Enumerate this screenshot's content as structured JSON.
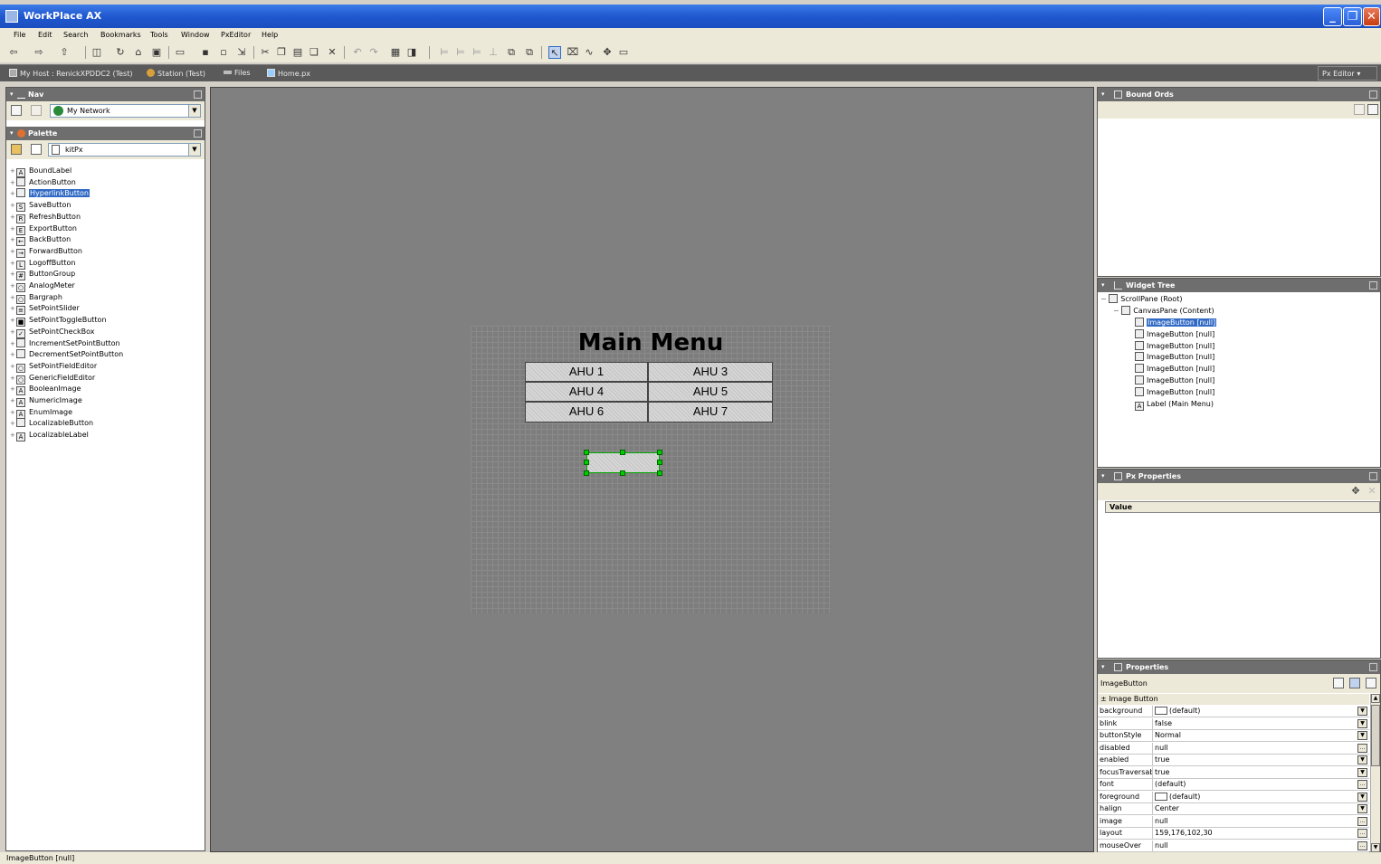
{
  "window": {
    "title": "WorkPlace AX"
  },
  "menu": [
    "File",
    "Edit",
    "Search",
    "Bookmarks",
    "Tools",
    "Window",
    "PxEditor",
    "Help"
  ],
  "location": {
    "crumbs": [
      "My Host : RenickXPDDC2 (Test)",
      "Station (Test)",
      "Files",
      "Home.px"
    ],
    "view_selector": "Px Editor"
  },
  "nav": {
    "title": "Nav",
    "selection": "My Network"
  },
  "palette": {
    "title": "Palette",
    "module": "kitPx",
    "items": [
      {
        "label": "BoundLabel",
        "icon": "A"
      },
      {
        "label": "ActionButton",
        "icon": ""
      },
      {
        "label": "HyperlinkButton",
        "icon": "",
        "selected": true
      },
      {
        "label": "SaveButton",
        "icon": "S"
      },
      {
        "label": "RefreshButton",
        "icon": "R"
      },
      {
        "label": "ExportButton",
        "icon": "E"
      },
      {
        "label": "BackButton",
        "icon": "←"
      },
      {
        "label": "ForwardButton",
        "icon": "→"
      },
      {
        "label": "LogoffButton",
        "icon": "L"
      },
      {
        "label": "ButtonGroup",
        "icon": "#"
      },
      {
        "label": "AnalogMeter",
        "icon": "○"
      },
      {
        "label": "Bargraph",
        "icon": "○"
      },
      {
        "label": "SetPointSlider",
        "icon": "≡"
      },
      {
        "label": "SetPointToggleButton",
        "icon": "■"
      },
      {
        "label": "SetPointCheckBox",
        "icon": "✓"
      },
      {
        "label": "IncrementSetPointButton",
        "icon": ""
      },
      {
        "label": "DecrementSetPointButton",
        "icon": ""
      },
      {
        "label": "SetPointFieldEditor",
        "icon": "○"
      },
      {
        "label": "GenericFieldEditor",
        "icon": "○"
      },
      {
        "label": "BooleanImage",
        "icon": "A"
      },
      {
        "label": "NumericImage",
        "icon": "A"
      },
      {
        "label": "EnumImage",
        "icon": "A"
      },
      {
        "label": "LocalizableButton",
        "icon": ""
      },
      {
        "label": "LocalizableLabel",
        "icon": "A"
      }
    ]
  },
  "canvas": {
    "heading": "Main Menu",
    "buttons": [
      "AHU 1",
      "AHU 3",
      "AHU 4",
      "AHU 5",
      "AHU 6",
      "AHU 7"
    ]
  },
  "bound_ords": {
    "title": "Bound Ords"
  },
  "widget_tree": {
    "title": "Widget Tree",
    "root": "ScrollPane (Root)",
    "content": "CanvasPane (Content)",
    "children": [
      {
        "label": "ImageButton [null]",
        "selected": true
      },
      {
        "label": "ImageButton [null]"
      },
      {
        "label": "ImageButton [null]"
      },
      {
        "label": "ImageButton [null]"
      },
      {
        "label": "ImageButton [null]"
      },
      {
        "label": "ImageButton [null]"
      },
      {
        "label": "ImageButton [null]"
      },
      {
        "label": "Label (Main Menu)",
        "icon": "A"
      }
    ]
  },
  "px_properties": {
    "title": "Px Properties",
    "column": "Value"
  },
  "properties": {
    "title": "Properties",
    "target": "ImageButton",
    "group": "Image Button",
    "rows": [
      {
        "name": "background",
        "value": "(default)",
        "swatch": true,
        "btn": "▼"
      },
      {
        "name": "blink",
        "value": "false",
        "btn": "▼"
      },
      {
        "name": "buttonStyle",
        "value": "Normal",
        "btn": "▼"
      },
      {
        "name": "disabled",
        "value": "null",
        "btn": "..."
      },
      {
        "name": "enabled",
        "value": "true",
        "btn": "▼"
      },
      {
        "name": "focusTraversable",
        "value": "true",
        "btn": "▼"
      },
      {
        "name": "font",
        "value": "(default)",
        "btn": "..."
      },
      {
        "name": "foreground",
        "value": "(default)",
        "swatch": true,
        "btn": "▼"
      },
      {
        "name": "halign",
        "value": "Center",
        "btn": "▼"
      },
      {
        "name": "image",
        "value": "null",
        "btn": "..."
      },
      {
        "name": "layout",
        "value": "159,176,102,30",
        "btn": "..."
      },
      {
        "name": "mouseOver",
        "value": "null",
        "btn": "..."
      }
    ]
  },
  "status": "ImageButton [null]"
}
